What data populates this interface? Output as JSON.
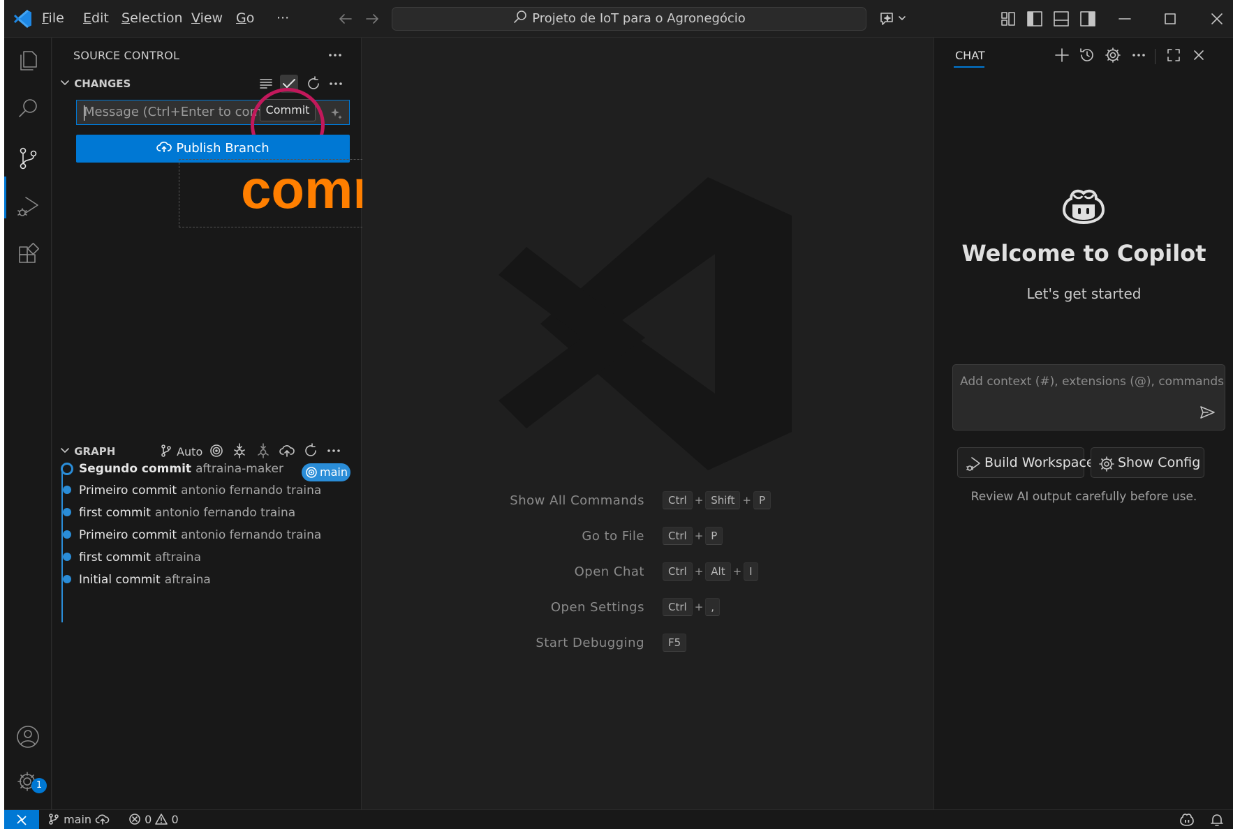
{
  "menu": {
    "items": [
      {
        "label": "File",
        "mnemonic": "F",
        "rest": "ile"
      },
      {
        "label": "Edit",
        "mnemonic": "E",
        "rest": "dit"
      },
      {
        "label": "Selection",
        "mnemonic": "S",
        "rest": "election"
      },
      {
        "label": "View",
        "mnemonic": "V",
        "rest": "iew"
      },
      {
        "label": "Go",
        "mnemonic": "G",
        "rest": "o"
      }
    ],
    "more": "···"
  },
  "command_center": {
    "text": "Projeto de IoT para o Agronegócio"
  },
  "source_control": {
    "title": "SOURCE CONTROL",
    "changes_header": "CHANGES",
    "message_placeholder": "Message (Ctrl+Enter to comm",
    "tooltip": "Commit",
    "publish_label": "Publish Branch",
    "annotation": "commit",
    "graph_header": "GRAPH",
    "graph_auto": "Auto",
    "branch_badge": "main",
    "commits": [
      {
        "message": "Segundo commit",
        "author": "aftraina-maker",
        "head": true
      },
      {
        "message": "Primeiro  commit",
        "author": "antonio fernando traina"
      },
      {
        "message": "first commit",
        "author": "antonio fernando traina"
      },
      {
        "message": "Primeiro commit",
        "author": "antonio fernando traina"
      },
      {
        "message": "first commit",
        "author": "aftraina"
      },
      {
        "message": "Initial commit",
        "author": "aftraina"
      }
    ]
  },
  "editor": {
    "shortcuts": [
      {
        "label": "Show All Commands",
        "keys": [
          "Ctrl",
          "Shift",
          "P"
        ]
      },
      {
        "label": "Go to File",
        "keys": [
          "Ctrl",
          "P"
        ]
      },
      {
        "label": "Open Chat",
        "keys": [
          "Ctrl",
          "Alt",
          "I"
        ]
      },
      {
        "label": "Open Settings",
        "keys": [
          "Ctrl",
          ","
        ]
      },
      {
        "label": "Start Debugging",
        "keys": [
          "F5"
        ]
      }
    ],
    "plus": "+"
  },
  "chat": {
    "tab_label": "CHAT",
    "welcome_title": "Welcome to Copilot",
    "welcome_subtitle": "Let's get started",
    "input_placeholder": "Add context (#), extensions (@), commands",
    "build_workspace": "Build Workspace",
    "show_config": "Show Config",
    "disclaimer": "Review AI output carefully before use."
  },
  "status_bar": {
    "branch": "main",
    "errors": "0",
    "warnings": "0"
  },
  "activity_bar": {
    "settings_badge": "1"
  },
  "colors": {
    "accent": "#0078d4",
    "annotation_text": "#ff7f00",
    "annotation_circle": "#c2185b",
    "graph": "#2a8dd8"
  }
}
